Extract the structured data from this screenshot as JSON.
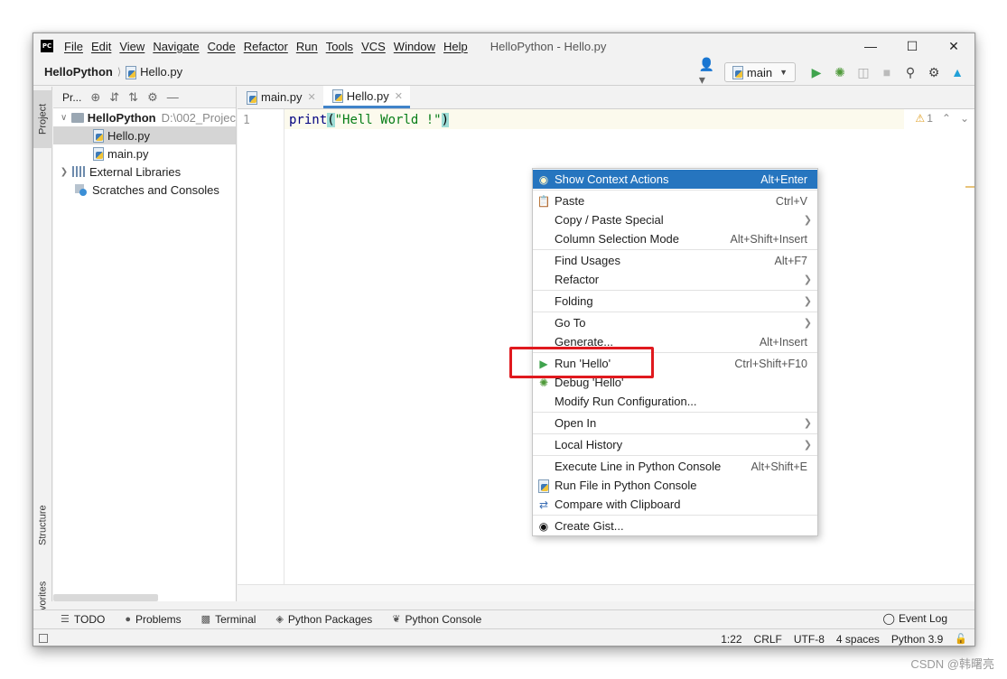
{
  "window": {
    "menu": [
      "File",
      "Edit",
      "View",
      "Navigate",
      "Code",
      "Refactor",
      "Run",
      "Tools",
      "VCS",
      "Window",
      "Help"
    ],
    "title": "HelloPython - Hello.py",
    "app_logo": "PC"
  },
  "navbar": {
    "project": "HelloPython",
    "file": "Hello.py",
    "run_config": "main"
  },
  "left_stripe": {
    "project": "Project",
    "structure": "Structure",
    "favorites": "Favorites"
  },
  "project_panel": {
    "header": "Pr...",
    "tree": [
      {
        "label": "HelloPython",
        "path": "D:\\002_Projec",
        "expanded": true
      },
      {
        "label": "Hello.py",
        "selected": true
      },
      {
        "label": "main.py"
      },
      {
        "label": "External Libraries"
      },
      {
        "label": "Scratches and Consoles"
      }
    ]
  },
  "editor": {
    "tabs": [
      {
        "label": "main.py",
        "active": false
      },
      {
        "label": "Hello.py",
        "active": true
      }
    ],
    "line_number": "1",
    "code": {
      "fn": "print",
      "open": "(",
      "str": "\"Hell World !\"",
      "close": ")"
    },
    "warnings": "1"
  },
  "context_menu": {
    "items": [
      {
        "label": "Show Context Actions",
        "shortcut": "Alt+Enter",
        "icon": "bulb-icon",
        "highlighted": true
      },
      {
        "label": "Paste",
        "shortcut": "Ctrl+V",
        "icon": "clipboard-icon"
      },
      {
        "label": "Copy / Paste Special",
        "submenu": true
      },
      {
        "label": "Column Selection Mode",
        "shortcut": "Alt+Shift+Insert"
      },
      {
        "label": "Find Usages",
        "shortcut": "Alt+F7"
      },
      {
        "label": "Refactor",
        "submenu": true
      },
      {
        "label": "Folding",
        "submenu": true
      },
      {
        "label": "Go To",
        "submenu": true
      },
      {
        "label": "Generate...",
        "shortcut": "Alt+Insert"
      },
      {
        "label": "Run 'Hello'",
        "shortcut": "Ctrl+Shift+F10",
        "icon": "run-icon"
      },
      {
        "label": "Debug 'Hello'",
        "icon": "debug-icon"
      },
      {
        "label": "Modify Run Configuration..."
      },
      {
        "label": "Open In",
        "submenu": true
      },
      {
        "label": "Local History",
        "submenu": true
      },
      {
        "label": "Execute Line in Python Console",
        "shortcut": "Alt+Shift+E"
      },
      {
        "label": "Run File in Python Console",
        "icon": "python-icon"
      },
      {
        "label": "Compare with Clipboard",
        "icon": "compare-icon"
      },
      {
        "label": "Create Gist...",
        "icon": "github-icon"
      }
    ]
  },
  "tool_windows": [
    "TODO",
    "Problems",
    "Terminal",
    "Python Packages",
    "Python Console"
  ],
  "event_log": "Event Log",
  "status": {
    "position": "1:22",
    "line_ending": "CRLF",
    "encoding": "UTF-8",
    "indent": "4 spaces",
    "interpreter": "Python 3.9"
  },
  "watermark": "CSDN @韩曙亮",
  "colors": {
    "highlight": "#2675bf",
    "annotation": "#e0191e",
    "tab_accent": "#4083c9"
  }
}
